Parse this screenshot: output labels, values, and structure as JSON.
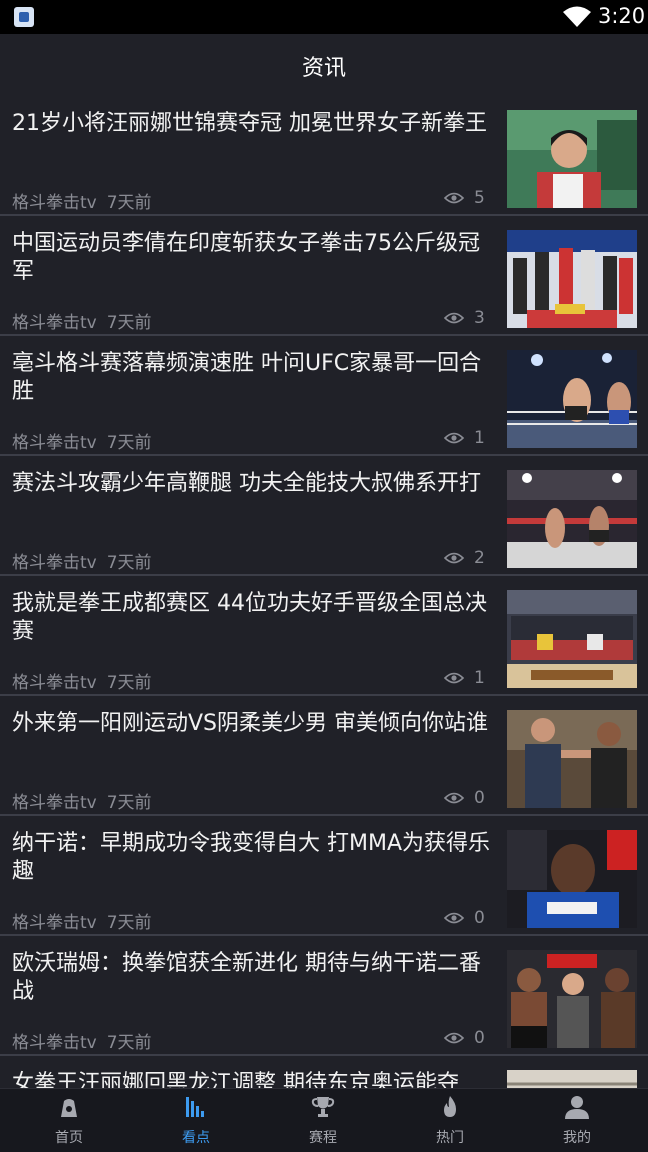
{
  "status_bar": {
    "time": "3:20",
    "app_icon": "app-icon",
    "wifi_icon": "wifi-icon"
  },
  "header": {
    "title": "资讯"
  },
  "news": [
    {
      "title": "21岁小将汪丽娜世锦赛夺冠 加冕世界女子新拳王",
      "source": "格斗拳击tv",
      "time": "7天前",
      "views": "5",
      "thumb": "boxer-portrait-image"
    },
    {
      "title": "中国运动员李倩在印度斩获女子拳击75公斤级冠军",
      "source": "格斗拳击tv",
      "time": "7天前",
      "views": "3",
      "thumb": "podium-ceremony-image"
    },
    {
      "title": "亳斗格斗赛落幕频演速胜 叶问UFC家暴哥一回合胜",
      "source": "格斗拳击tv",
      "time": "7天前",
      "views": "1",
      "thumb": "ring-fight-image"
    },
    {
      "title": "赛法斗攻霸少年高鞭腿 功夫全能技大叔佛系开打",
      "source": "格斗拳击tv",
      "time": "7天前",
      "views": "2",
      "thumb": "kick-fight-image"
    },
    {
      "title": "我就是拳王成都赛区 44位功夫好手晋级全国总决赛",
      "source": "格斗拳击tv",
      "time": "7天前",
      "views": "1",
      "thumb": "group-photo-image"
    },
    {
      "title": "外来第一阳刚运动VS阴柔美少男 审美倾向你站谁",
      "source": "格斗拳击tv",
      "time": "7天前",
      "views": "0",
      "thumb": "faceoff-image"
    },
    {
      "title": "纳干诺：早期成功令我变得自大 打MMA为获得乐趣",
      "source": "格斗拳击tv",
      "time": "7天前",
      "views": "0",
      "thumb": "ufc-fighter-image"
    },
    {
      "title": "欧沃瑞姆：换拳馆获全新进化 期待与纳干诺二番战",
      "source": "格斗拳击tv",
      "time": "7天前",
      "views": "0",
      "thumb": "ufc-weighin-image"
    },
    {
      "title": "女拳王汪丽娜回黑龙江调整 期待东京奥运能夺",
      "source": "",
      "time": "",
      "views": "",
      "thumb": "gym-image"
    }
  ],
  "eye_icon": "eye-icon",
  "tabs": [
    {
      "label": "首页",
      "icon": "home-bag-icon",
      "active": false
    },
    {
      "label": "看点",
      "icon": "bar-chart-icon",
      "active": true
    },
    {
      "label": "赛程",
      "icon": "trophy-icon",
      "active": false
    },
    {
      "label": "热门",
      "icon": "flame-icon",
      "active": false
    },
    {
      "label": "我的",
      "icon": "person-icon",
      "active": false
    }
  ],
  "colors": {
    "background": "#202128",
    "accent": "#3d9bf0",
    "tab_bar": "#17181e",
    "divider": "#3c3e48"
  }
}
